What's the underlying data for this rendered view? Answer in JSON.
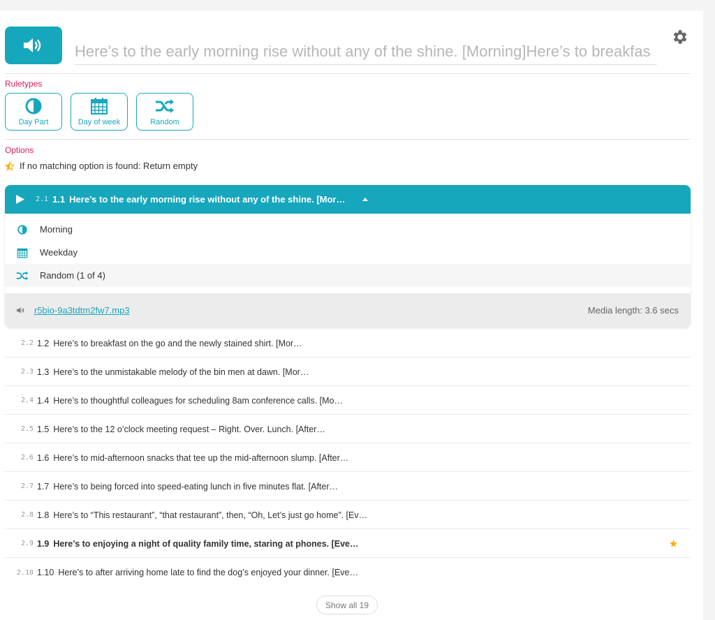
{
  "header": {
    "title_value": "Here’s to the early morning rise without any of the shine. [Morning]Here’s to breakfas"
  },
  "ruletypes": {
    "label": "Ruletypes",
    "buttons": [
      {
        "label": "Day Part",
        "icon": "half-circle-icon"
      },
      {
        "label": "Day of week",
        "icon": "calendar-icon"
      },
      {
        "label": "Random",
        "icon": "shuffle-icon"
      }
    ]
  },
  "options": {
    "label": "Options",
    "text": "If no matching option is found: Return empty",
    "icon": "star-half-icon"
  },
  "expanded_item": {
    "index": "2.1",
    "number": "1.1",
    "text": "Here’s to the early morning rise without any of the shine. [Mor…",
    "conditions": [
      {
        "icon": "half-circle-icon",
        "label": "Morning"
      },
      {
        "icon": "calendar-icon",
        "label": "Weekday"
      },
      {
        "icon": "shuffle-icon",
        "label": "Random (1 of 4)"
      }
    ],
    "media_file": "r5bio-9a3tdtm2fw7.mp3",
    "media_length": "Media length: 3.6 secs"
  },
  "items": [
    {
      "index": "2.2",
      "number": "1.2",
      "text": "Here’s to breakfast on the go and the newly stained shirt. [Mor…"
    },
    {
      "index": "2.3",
      "number": "1.3",
      "text": "Here’s to the unmistakable melody of the bin men at dawn. [Mor…"
    },
    {
      "index": "2.4",
      "number": "1.4",
      "text": "Here’s to thoughtful colleagues for scheduling 8am conference calls. [Mo…"
    },
    {
      "index": "2.5",
      "number": "1.5",
      "text": "Here’s to the 12 o’clock meeting request – Right. Over. Lunch. [After…"
    },
    {
      "index": "2.6",
      "number": "1.6",
      "text": "Here’s to mid-afternoon snacks that tee up the mid-afternoon slump. [After…"
    },
    {
      "index": "2.7",
      "number": "1.7",
      "text": "Here’s to being forced into speed-eating lunch in five minutes flat. [After…"
    },
    {
      "index": "2.8",
      "number": "1.8",
      "text": "Here’s to “This restaurant”, “that restaurant”, then, “Oh, Let’s just go home”. [Ev…"
    },
    {
      "index": "2.9",
      "number": "1.9",
      "text": "Here’s to enjoying a night of quality family time, staring at phones. [Eve…"
    },
    {
      "index": "2.10",
      "number": "1.10",
      "text": "Here’s to after arriving home late to find the dog’s enjoyed your dinner. [Eve…"
    }
  ],
  "show_all_label": "Show all 19",
  "colors": {
    "accent": "#17a7bd",
    "label_pink": "#d81b60",
    "star": "#f5b300"
  }
}
